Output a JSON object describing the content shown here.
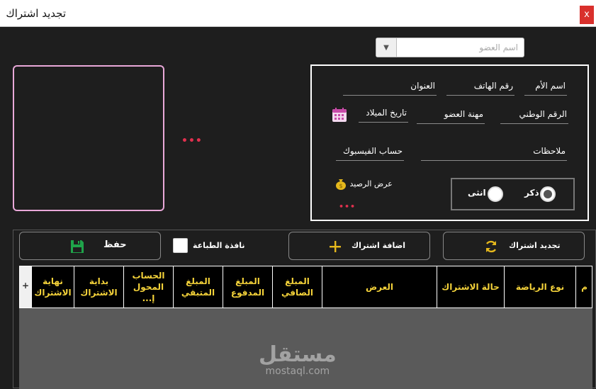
{
  "window": {
    "title": "تجديد اشتراك",
    "close_label": "x"
  },
  "member_search": {
    "placeholder": "اسم العضو",
    "value": ""
  },
  "info": {
    "mother_name_label": "اسم الأم",
    "phone_label": "رقم الهاتف",
    "address_label": "العنوان",
    "national_id_label": "الرقم الوطني",
    "job_label": "مهنة العضو",
    "birth_date_label": "تاريخ الميلاد",
    "notes_label": "ملاحظات",
    "facebook_label": "حساب الفيسبوك",
    "balance_label": "عرض الرصيد",
    "gender": {
      "male_label": "ذكر",
      "female_label": "انثى",
      "selected": "male"
    }
  },
  "indicators": {
    "photo_dots": "•••",
    "balance_dots": "•••"
  },
  "toolbar": {
    "renew_label": "تجديد اشتراك",
    "add_label": "اضافة اشتراك",
    "print_label": "نافذة الطباعة",
    "save_label": "حفظ"
  },
  "grid": {
    "add_symbol": "+",
    "columns": [
      "م",
      "نوع الرياضة",
      "حالة الاشتراك",
      "العرض",
      "المبلغ الصافي",
      "المبلغ المدفوع",
      "المبلغ المتبقي",
      "الحساب المحول إ...",
      "بداية الاشتراك",
      "نهاية الاشتراك"
    ]
  },
  "watermark": {
    "arabic": "مستقل",
    "latin": "mostaql.com"
  },
  "colors": {
    "accent_yellow": "#f5d33a",
    "photo_border": "#e9a8d9",
    "dots_red": "#e0304e",
    "save_green": "#1fa34a"
  }
}
